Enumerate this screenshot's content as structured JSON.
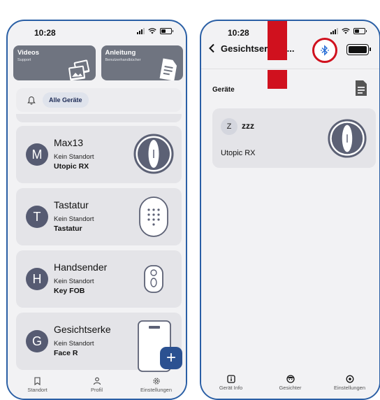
{
  "left": {
    "status": {
      "time": "10:28"
    },
    "tiles": [
      {
        "title": "Videos",
        "subtitle": "Support",
        "icon": "video-cards-icon"
      },
      {
        "title": "Anleitung",
        "subtitle": "Benutzerhandbücher",
        "icon": "document-icon"
      }
    ],
    "filter": {
      "icon": "bell-icon",
      "chip": "Alle Geräte"
    },
    "devices": [
      {
        "initial": "M",
        "name": "Max13",
        "location": "Kein Standort",
        "type": "Utopic RX",
        "icon": "smart-lock-icon"
      },
      {
        "initial": "T",
        "name": "Tastatur",
        "location": "Kein Standort",
        "type": "Tastatur",
        "icon": "keypad-icon"
      },
      {
        "initial": "H",
        "name": "Handsender",
        "location": "Kein Standort",
        "type": "Key FOB",
        "icon": "key-fob-icon"
      },
      {
        "initial": "G",
        "name": "Gesichtserke",
        "location": "Kein Standort",
        "type": "Face R",
        "icon": "face-reader-icon"
      }
    ],
    "fab": "+",
    "tabs": [
      {
        "label": "Standort",
        "icon": "bookmark-icon"
      },
      {
        "label": "Profil",
        "icon": "person-icon"
      },
      {
        "label": "Einstellungen",
        "icon": "gear-icon"
      }
    ]
  },
  "right": {
    "status": {
      "time": "10:28"
    },
    "header": {
      "title": "Gesichtser   nnu...",
      "bluetooth_icon": "bluetooth-icon",
      "highlight_color": "#d0111e"
    },
    "section_title": "Geräte",
    "device": {
      "initial": "Z",
      "name": "zzz",
      "type": "Utopic RX",
      "icon": "smart-lock-icon"
    },
    "tabs": [
      {
        "label": "Gerät Info",
        "icon": "info-icon"
      },
      {
        "label": "Gesichter",
        "icon": "face-icon"
      },
      {
        "label": "Einstellungen",
        "icon": "settings-icon"
      }
    ]
  },
  "colors": {
    "accent": "#2b5191",
    "avatar": "#565b72",
    "alert": "#d0111e",
    "frame": "#2a5fa5"
  }
}
